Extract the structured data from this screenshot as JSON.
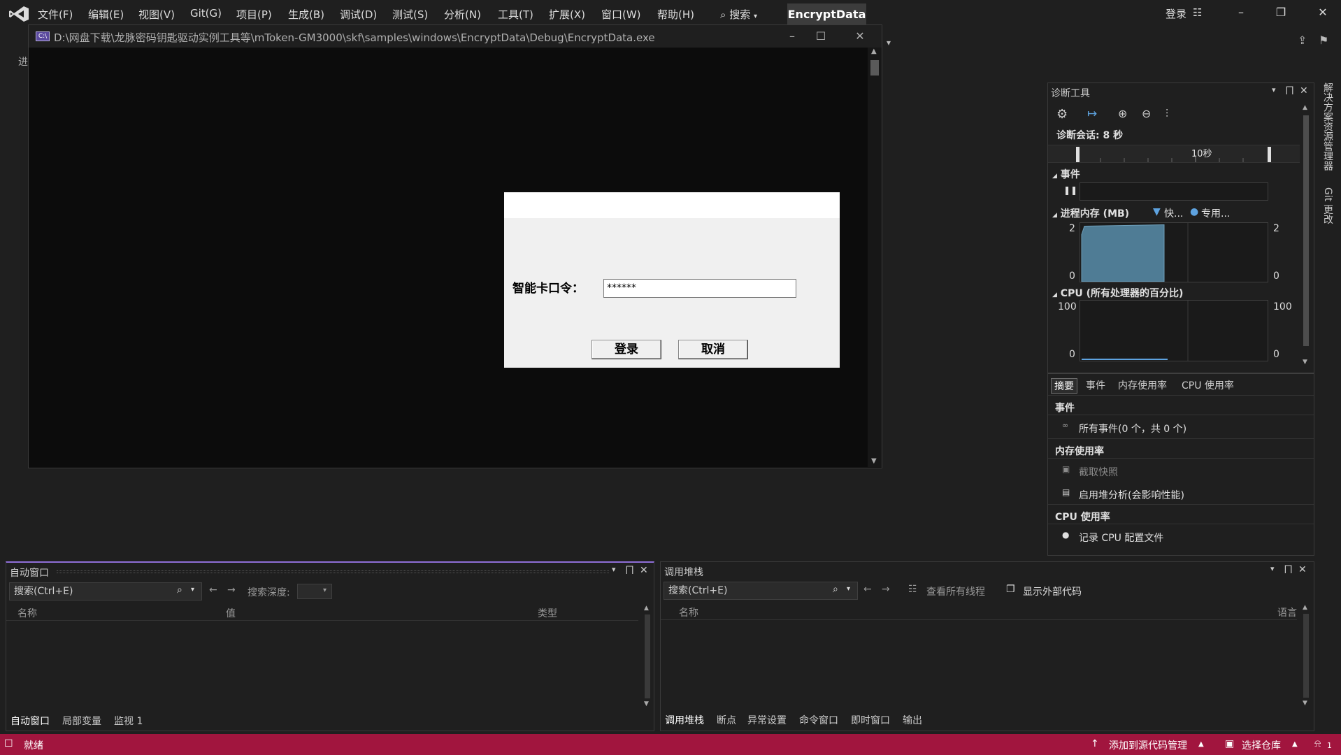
{
  "menubar": {
    "items": [
      "文件(F)",
      "编辑(E)",
      "视图(V)",
      "Git(G)",
      "项目(P)",
      "生成(B)",
      "调试(D)",
      "测试(S)",
      "分析(N)",
      "工具(T)",
      "扩展(X)",
      "窗口(W)",
      "帮助(H)"
    ],
    "search_label": "搜索",
    "project_name": "EncryptData",
    "login_label": "登录"
  },
  "left_gutter_text": "进",
  "console": {
    "icon_text": "C:\\",
    "path": "D:\\网盘下载\\龙脉密码钥匙驱动实例工具等\\mToken-GM3000\\skf\\samples\\windows\\EncryptData\\Debug\\EncryptData.exe"
  },
  "dialog": {
    "label": "智能卡口令：",
    "password_value": "******",
    "login_button": "登录",
    "cancel_button": "取消"
  },
  "diagnostics": {
    "title": "诊断工具",
    "session": "诊断会话: 8 秒",
    "ruler_label": "10秒",
    "events_section": "事件",
    "memory_section": "进程内存 (MB)",
    "memory_legend_1": "快...",
    "memory_legend_2": "专用...",
    "memory_max": "2",
    "memory_min": "0",
    "memory_level": 0.97,
    "cpu_section": "CPU (所有处理器的百分比)",
    "cpu_max": "100",
    "cpu_min": "0",
    "tabs": [
      "摘要",
      "事件",
      "内存使用率",
      "CPU 使用率"
    ],
    "summary": {
      "events_head": "事件",
      "events_all": "所有事件(0 个，共 0 个)",
      "memory_head": "内存使用率",
      "snapshot": "截取快照",
      "heap_analysis": "启用堆分析(会影响性能)",
      "cpu_head": "CPU 使用率",
      "record_cpu": "记录 CPU 配置文件"
    }
  },
  "right_tabs": [
    "解决方案资源管理器",
    "Git 更改"
  ],
  "autos": {
    "title": "自动窗口",
    "search_placeholder": "搜索(Ctrl+E)",
    "depth_label": "搜索深度:",
    "columns": [
      "名称",
      "值",
      "类型"
    ],
    "tabs": [
      "自动窗口",
      "局部变量",
      "监视 1"
    ]
  },
  "callstack": {
    "title": "调用堆栈",
    "search_placeholder": "搜索(Ctrl+E)",
    "view_threads": "查看所有线程",
    "show_external": "显示外部代码",
    "columns": [
      "名称",
      "语言"
    ],
    "tabs": [
      "调用堆栈",
      "断点",
      "异常设置",
      "命令窗口",
      "即时窗口",
      "输出"
    ]
  },
  "statusbar": {
    "ready": "就绪",
    "add_source_control": "添加到源代码管理",
    "select_repo": "选择仓库",
    "notifications": "1"
  },
  "colors": {
    "statusbar": "#a1153e",
    "memory_fill": "#4f7c95",
    "accent": "#8f6fd8"
  }
}
